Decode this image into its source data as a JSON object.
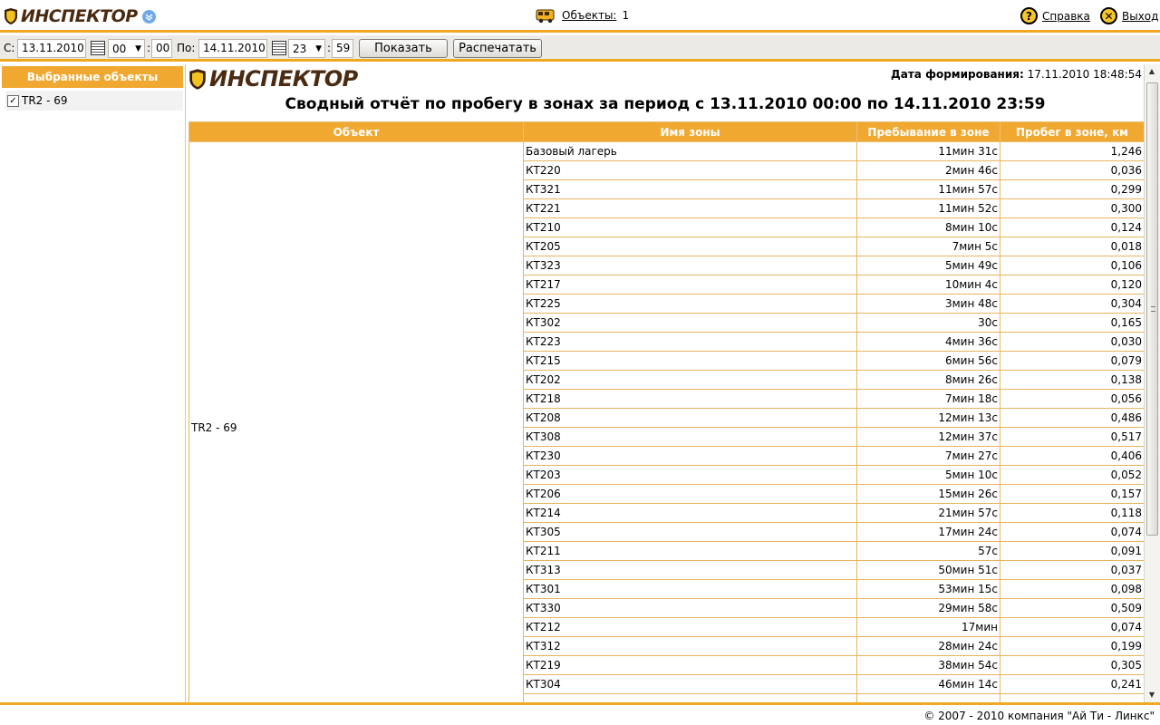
{
  "app": {
    "brand": "ИНСПЕКТОР",
    "objects_label": "Объекты:",
    "objects_count": "1",
    "help_label": "Справка",
    "exit_label": "Выход"
  },
  "filter": {
    "from_label": "С:",
    "from_date": "13.11.2010",
    "from_hour": "00",
    "from_minute": "00",
    "to_label": "По:",
    "to_date": "14.11.2010",
    "to_hour": "23",
    "to_minute": "59",
    "show_button": "Показать",
    "print_button": "Распечатать"
  },
  "left_panel": {
    "header": "Выбранные объекты",
    "items": [
      {
        "label": "TR2 - 69",
        "checked": true
      }
    ]
  },
  "report": {
    "gen_date_label": "Дата формирования:",
    "gen_date_value": "17.11.2010 18:48:54",
    "title": "Сводный отчёт по пробегу в зонах за период с 13.11.2010 00:00 по 14.11.2010 23:59",
    "columns": [
      "Объект",
      "Имя зоны",
      "Пребывание в зоне",
      "Пробег в зоне, км"
    ],
    "object_name": "TR2 - 69",
    "rows": [
      {
        "zone": "Базовый лагерь",
        "stay": "11мин 31с",
        "distance": "1,246"
      },
      {
        "zone": "КТ220",
        "stay": "2мин 46с",
        "distance": "0,036"
      },
      {
        "zone": "КТ321",
        "stay": "11мин 57с",
        "distance": "0,299"
      },
      {
        "zone": "КТ221",
        "stay": "11мин 52с",
        "distance": "0,300"
      },
      {
        "zone": "КТ210",
        "stay": "8мин 10с",
        "distance": "0,124"
      },
      {
        "zone": "КТ205",
        "stay": "7мин 5с",
        "distance": "0,018"
      },
      {
        "zone": "КТ323",
        "stay": "5мин 49с",
        "distance": "0,106"
      },
      {
        "zone": "КТ217",
        "stay": "10мин 4с",
        "distance": "0,120"
      },
      {
        "zone": "КТ225",
        "stay": "3мин 48с",
        "distance": "0,304"
      },
      {
        "zone": "КТ302",
        "stay": "30с",
        "distance": "0,165"
      },
      {
        "zone": "КТ223",
        "stay": "4мин 36с",
        "distance": "0,030"
      },
      {
        "zone": "КТ215",
        "stay": "6мин 56с",
        "distance": "0,079"
      },
      {
        "zone": "КТ202",
        "stay": "8мин 26с",
        "distance": "0,138"
      },
      {
        "zone": "КТ218",
        "stay": "7мин 18с",
        "distance": "0,056"
      },
      {
        "zone": "КТ208",
        "stay": "12мин 13с",
        "distance": "0,486"
      },
      {
        "zone": "КТ308",
        "stay": "12мин 37с",
        "distance": "0,517"
      },
      {
        "zone": "КТ230",
        "stay": "7мин 27с",
        "distance": "0,406"
      },
      {
        "zone": "КТ203",
        "stay": "5мин 10с",
        "distance": "0,052"
      },
      {
        "zone": "КТ206",
        "stay": "15мин 26с",
        "distance": "0,157"
      },
      {
        "zone": "КТ214",
        "stay": "21мин 57с",
        "distance": "0,118"
      },
      {
        "zone": "КТ305",
        "stay": "17мин 24с",
        "distance": "0,074"
      },
      {
        "zone": "КТ211",
        "stay": "57с",
        "distance": "0,091"
      },
      {
        "zone": "КТ313",
        "stay": "50мин 51с",
        "distance": "0,037"
      },
      {
        "zone": "КТ301",
        "stay": "53мин 15с",
        "distance": "0,098"
      },
      {
        "zone": "КТ330",
        "stay": "29мин 58с",
        "distance": "0,509"
      },
      {
        "zone": "КТ212",
        "stay": "17мин",
        "distance": "0,074"
      },
      {
        "zone": "КТ312",
        "stay": "28мин 24с",
        "distance": "0,199"
      },
      {
        "zone": "КТ219",
        "stay": "38мин 54с",
        "distance": "0,305"
      },
      {
        "zone": "КТ304",
        "stay": "46мин 14с",
        "distance": "0,241"
      }
    ]
  },
  "footer": {
    "copyright": "© 2007 - 2010 компания \"Ай Ти - Линкс\""
  },
  "colors": {
    "accent": "#f0a820",
    "header_fill": "#f0a830",
    "brand_text": "#4a2a10"
  }
}
